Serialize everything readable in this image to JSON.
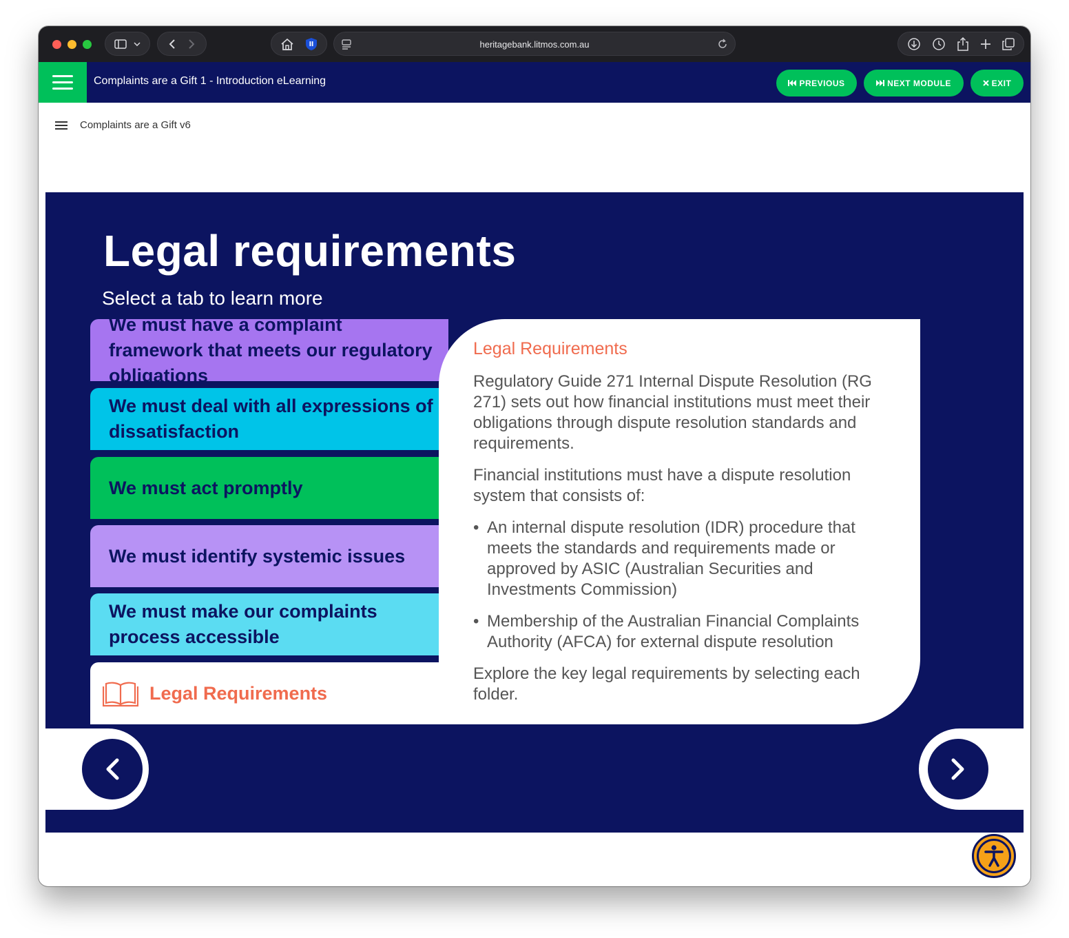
{
  "browser": {
    "url": "heritagebank.litmos.com.au"
  },
  "lms": {
    "course_title": "Complaints are a Gift 1 - Introduction eLearning",
    "previous_label": "PREVIOUS",
    "next_label": "NEXT MODULE",
    "exit_label": "EXIT",
    "module_title": "Complaints are a Gift v6"
  },
  "slide": {
    "title": "Legal requirements",
    "subtitle": "Select a tab to learn more",
    "tabs": [
      {
        "label": "We must have a complaint framework that meets our regulatory obligations"
      },
      {
        "label": "We must deal with all expressions of dissatisfaction"
      },
      {
        "label": "We must act promptly"
      },
      {
        "label": "We must identify systemic issues"
      },
      {
        "label": "We must make our complaints process accessible"
      },
      {
        "label": "Legal Requirements"
      }
    ],
    "panel": {
      "heading": "Legal Requirements",
      "paragraph1": "Regulatory Guide 271 Internal Dispute Resolution (RG 271) sets out how financial institutions must meet their obligations through dispute resolution standards and requirements.",
      "paragraph2": "Financial institutions must have a dispute resolution system that consists of:",
      "bullets": [
        "An internal dispute resolution (IDR) procedure that meets the standards and requirements made or approved by ASIC (Australian Securities and Investments Commission)",
        "Membership of the Australian Financial Complaints Authority (AFCA) for external dispute resolution"
      ],
      "paragraph3": "Explore the key legal requirements by selecting each folder."
    }
  },
  "colors": {
    "navy": "#0c1460",
    "green": "#00c05a",
    "purple": "#a675f0",
    "cyan": "#00c4e8",
    "lavender": "#b792f5",
    "light_cyan": "#5bdcf2",
    "coral": "#f06b4e",
    "accessibility_orange": "#f5a118"
  },
  "icons": [
    "sidebar-icon",
    "back-icon",
    "forward-icon",
    "home-icon",
    "shield-icon",
    "page-icon",
    "reload-icon",
    "download-icon",
    "history-icon",
    "share-icon",
    "new-tab-icon",
    "tabs-icon",
    "hamburger-icon",
    "book-icon",
    "chevron-left-icon",
    "chevron-right-icon",
    "accessibility-icon"
  ]
}
